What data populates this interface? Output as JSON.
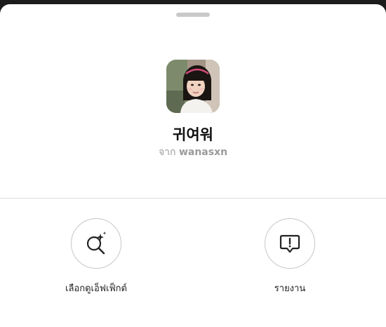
{
  "effect": {
    "name": "귀여워",
    "by_prefix": "จาก",
    "creator": "wanasxn",
    "thumbnail_icon": "effect-preview-thumbnail"
  },
  "actions": [
    {
      "label": "เลือกดูเอ็ฟเฟ็กต์",
      "icon": "search-sparkle-icon"
    },
    {
      "label": "รายงาน",
      "icon": "report-speech-bubble-icon"
    }
  ],
  "colors": {
    "sheet_background": "#ffffff",
    "grabber": "#c9c9c9",
    "divider": "#dbdbdb",
    "circle_border": "#c7c7c7",
    "secondary_text": "#9a9a9a"
  }
}
